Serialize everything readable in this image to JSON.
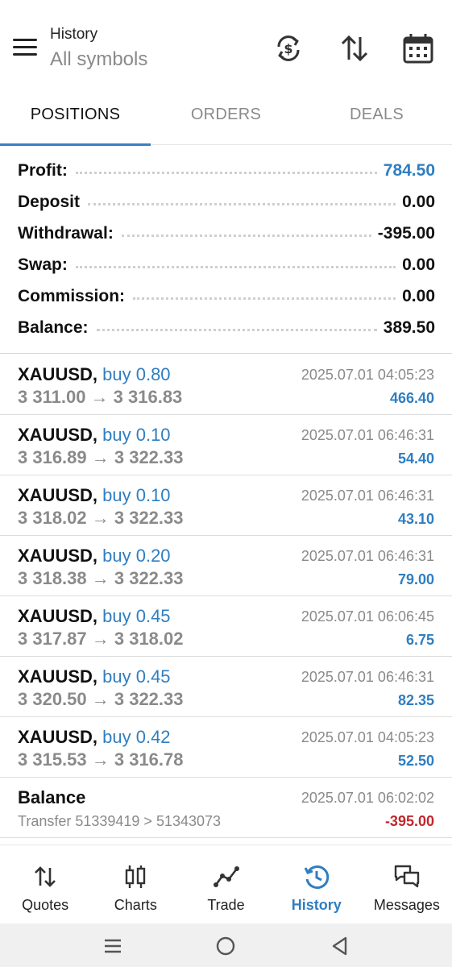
{
  "header": {
    "title": "History",
    "subtitle": "All symbols",
    "icons": [
      "menu-icon",
      "currency-exchange-icon",
      "sort-icon",
      "calendar-icon"
    ]
  },
  "tabs": [
    {
      "label": "POSITIONS",
      "active": true
    },
    {
      "label": "ORDERS",
      "active": false
    },
    {
      "label": "DEALS",
      "active": false
    }
  ],
  "summary": [
    {
      "label": "Profit:",
      "value": "784.50"
    },
    {
      "label": "Deposit",
      "value": "0.00"
    },
    {
      "label": "Withdrawal:",
      "value": "-395.00"
    },
    {
      "label": "Swap:",
      "value": "0.00"
    },
    {
      "label": "Commission:",
      "value": "0.00"
    },
    {
      "label": "Balance:",
      "value": "389.50"
    }
  ],
  "deals": [
    {
      "symbol": "XAUUSD,",
      "side": "buy 0.80",
      "prices": "3 311.00 → 3 316.83",
      "time": "2025.07.01 04:05:23",
      "pl": "466.40"
    },
    {
      "symbol": "XAUUSD,",
      "side": "buy 0.10",
      "prices": "3 316.89 → 3 322.33",
      "time": "2025.07.01 06:46:31",
      "pl": "54.40"
    },
    {
      "symbol": "XAUUSD,",
      "side": "buy 0.10",
      "prices": "3 318.02 → 3 322.33",
      "time": "2025.07.01 06:46:31",
      "pl": "43.10"
    },
    {
      "symbol": "XAUUSD,",
      "side": "buy 0.20",
      "prices": "3 318.38 → 3 322.33",
      "time": "2025.07.01 06:46:31",
      "pl": "79.00"
    },
    {
      "symbol": "XAUUSD,",
      "side": "buy 0.45",
      "prices": "3 317.87 → 3 318.02",
      "time": "2025.07.01 06:06:45",
      "pl": "6.75"
    },
    {
      "symbol": "XAUUSD,",
      "side": "buy 0.45",
      "prices": "3 320.50 → 3 322.33",
      "time": "2025.07.01 06:46:31",
      "pl": "82.35"
    },
    {
      "symbol": "XAUUSD,",
      "side": "buy 0.42",
      "prices": "3 315.53 → 3 316.78",
      "time": "2025.07.01 04:05:23",
      "pl": "52.50"
    }
  ],
  "balance_entry": {
    "title": "Balance",
    "detail": "Transfer 51339419 > 51343073",
    "time": "2025.07.01 06:02:02",
    "amount": "-395.00"
  },
  "bottom_nav": [
    {
      "label": "Quotes",
      "icon": "quotes-icon",
      "active": false
    },
    {
      "label": "Charts",
      "icon": "charts-icon",
      "active": false
    },
    {
      "label": "Trade",
      "icon": "trade-icon",
      "active": false
    },
    {
      "label": "History",
      "icon": "history-icon",
      "active": true
    },
    {
      "label": "Messages",
      "icon": "messages-icon",
      "active": false
    }
  ],
  "colors": {
    "accent": "#2f7ec1",
    "negative": "#c0272d",
    "muted": "#8a8a8a"
  }
}
